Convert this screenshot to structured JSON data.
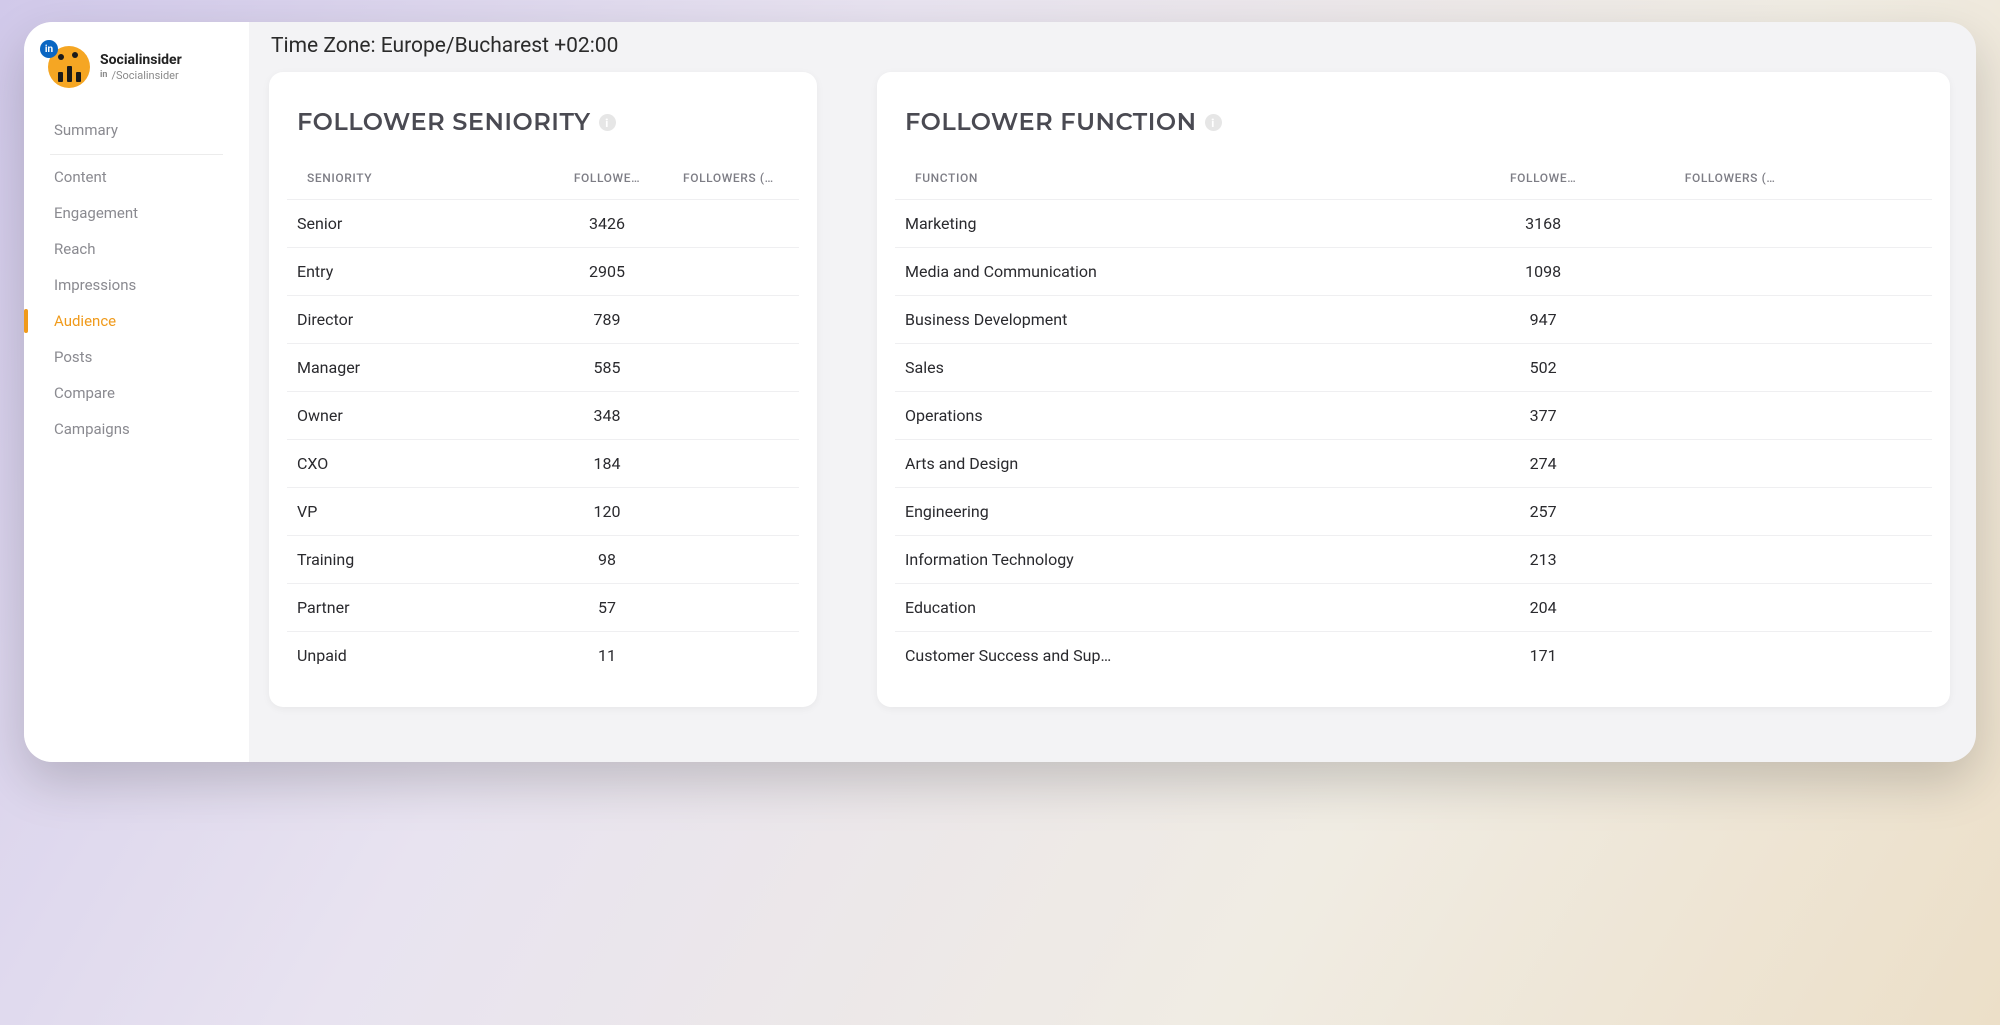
{
  "profile": {
    "name": "Socialinsider",
    "handle": "/Socialinsider",
    "platform_badge": "in"
  },
  "sidebar": {
    "items": [
      {
        "label": "Summary",
        "active": false,
        "separator_after": true
      },
      {
        "label": "Content",
        "active": false
      },
      {
        "label": "Engagement",
        "active": false
      },
      {
        "label": "Reach",
        "active": false
      },
      {
        "label": "Impressions",
        "active": false
      },
      {
        "label": "Audience",
        "active": true
      },
      {
        "label": "Posts",
        "active": false
      },
      {
        "label": "Compare",
        "active": false
      },
      {
        "label": "Campaigns",
        "active": false
      }
    ]
  },
  "header": {
    "timezone_label": "Time Zone: Europe/Bucharest +02:00"
  },
  "cards": {
    "seniority": {
      "title": "FOLLOWER SENIORITY",
      "columns": [
        "SENIORITY",
        "FOLLOWE…",
        "FOLLOWERS (…"
      ],
      "rows": [
        {
          "label": "Senior",
          "value": "3426"
        },
        {
          "label": "Entry",
          "value": "2905"
        },
        {
          "label": "Director",
          "value": "789"
        },
        {
          "label": "Manager",
          "value": "585"
        },
        {
          "label": "Owner",
          "value": "348"
        },
        {
          "label": "CXO",
          "value": "184"
        },
        {
          "label": "VP",
          "value": "120"
        },
        {
          "label": "Training",
          "value": "98"
        },
        {
          "label": "Partner",
          "value": "57"
        },
        {
          "label": "Unpaid",
          "value": "11"
        }
      ]
    },
    "function": {
      "title": "FOLLOWER FUNCTION",
      "columns": [
        "FUNCTION",
        "FOLLOWE…",
        "FOLLOWERS (…"
      ],
      "rows": [
        {
          "label": "Marketing",
          "value": "3168"
        },
        {
          "label": "Media and Communication",
          "value": "1098"
        },
        {
          "label": "Business Development",
          "value": "947"
        },
        {
          "label": "Sales",
          "value": "502"
        },
        {
          "label": "Operations",
          "value": "377"
        },
        {
          "label": "Arts and Design",
          "value": "274"
        },
        {
          "label": "Engineering",
          "value": "257"
        },
        {
          "label": "Information Technology",
          "value": "213"
        },
        {
          "label": "Education",
          "value": "204"
        },
        {
          "label": "Customer Success and Sup…",
          "value": "171"
        }
      ]
    }
  },
  "chart_data": [
    {
      "type": "table",
      "title": "FOLLOWER SENIORITY",
      "categories": [
        "Senior",
        "Entry",
        "Director",
        "Manager",
        "Owner",
        "CXO",
        "VP",
        "Training",
        "Partner",
        "Unpaid"
      ],
      "values": [
        3426,
        2905,
        789,
        585,
        348,
        184,
        120,
        98,
        57,
        11
      ],
      "xlabel": "SENIORITY",
      "ylabel": "FOLLOWERS"
    },
    {
      "type": "table",
      "title": "FOLLOWER FUNCTION",
      "categories": [
        "Marketing",
        "Media and Communication",
        "Business Development",
        "Sales",
        "Operations",
        "Arts and Design",
        "Engineering",
        "Information Technology",
        "Education",
        "Customer Success and Support"
      ],
      "values": [
        3168,
        1098,
        947,
        502,
        377,
        274,
        257,
        213,
        204,
        171
      ],
      "xlabel": "FUNCTION",
      "ylabel": "FOLLOWERS"
    }
  ]
}
